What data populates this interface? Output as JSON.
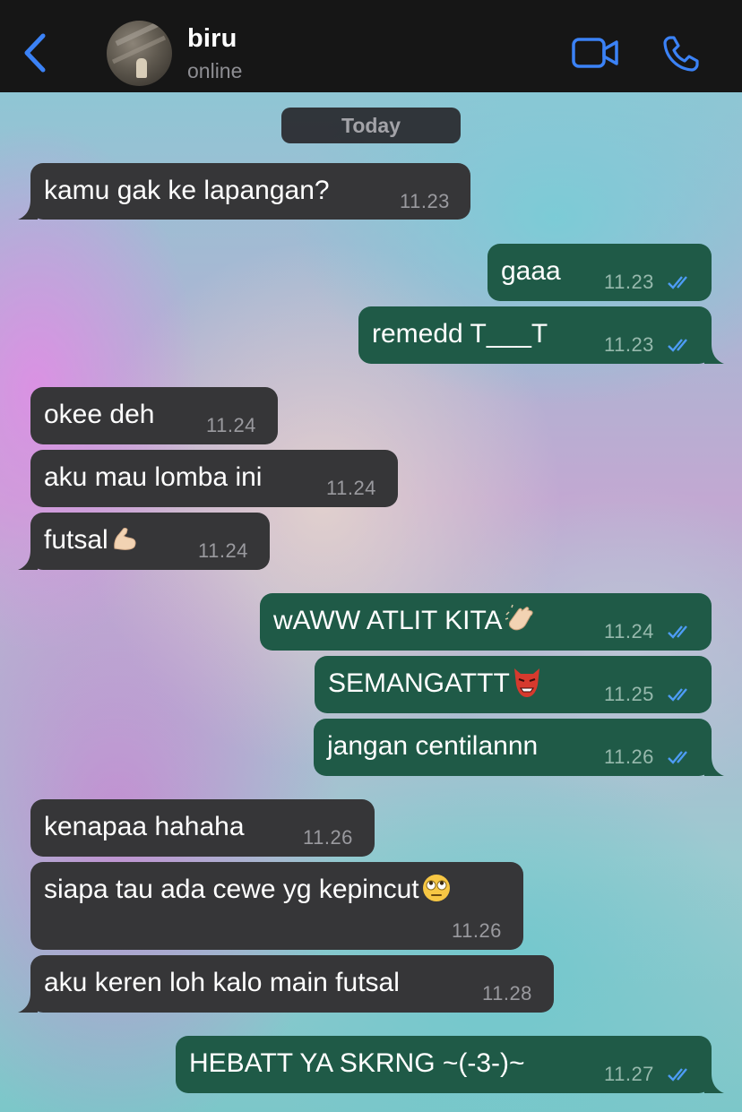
{
  "header": {
    "contact_name": "biru",
    "status": "online",
    "icons": {
      "back": "chevron-left-icon",
      "video": "video-camera-icon",
      "call": "phone-icon"
    },
    "accent_color": "#3b82f6"
  },
  "chat": {
    "date_label": "Today",
    "colors": {
      "incoming": "#363638",
      "outgoing": "#1f5a47",
      "read_ticks": "#4d9cf5"
    },
    "messages": [
      {
        "direction": "in",
        "text": "kamu gak ke lapangan?",
        "time": "11.23"
      },
      {
        "direction": "out",
        "text": "gaaa",
        "time": "11.23",
        "status": "read"
      },
      {
        "direction": "out",
        "text": "remedd T___T",
        "time": "11.23",
        "status": "read"
      },
      {
        "direction": "in",
        "text": "okee deh",
        "time": "11.24"
      },
      {
        "direction": "in",
        "text": "aku mau lomba ini",
        "time": "11.24"
      },
      {
        "direction": "in",
        "text": "futsal",
        "emoji": "flexed-biceps",
        "time": "11.24"
      },
      {
        "direction": "out",
        "text": "wAWW ATLIT KITA",
        "emoji": "clapping-hands",
        "time": "11.24",
        "status": "read"
      },
      {
        "direction": "out",
        "text": "SEMANGATTT",
        "emoji": "goblin",
        "time": "11.25",
        "status": "read"
      },
      {
        "direction": "out",
        "text": "jangan centilannn",
        "time": "11.26",
        "status": "read"
      },
      {
        "direction": "in",
        "text": "kenapaa hahaha",
        "time": "11.26"
      },
      {
        "direction": "in",
        "text": "siapa tau ada cewe yg kepincut",
        "emoji": "face-with-rolling-eyes",
        "time": "11.26"
      },
      {
        "direction": "in",
        "text": "aku keren loh kalo main futsal",
        "time": "11.28"
      },
      {
        "direction": "out",
        "text": "HEBATT YA SKRNG ~(-3-)~",
        "time": "11.27",
        "status": "read"
      }
    ]
  }
}
